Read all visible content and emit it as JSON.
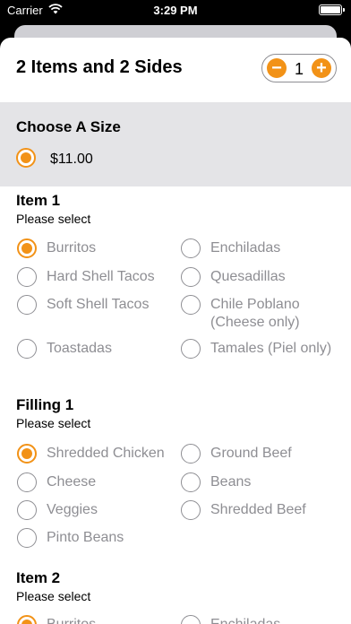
{
  "status": {
    "carrier": "Carrier",
    "time": "3:29 PM"
  },
  "header": {
    "title": "2 Items and 2 Sides",
    "quantity": "1",
    "minus": "−",
    "plus": "+"
  },
  "size": {
    "title": "Choose A Size",
    "price": "$11.00"
  },
  "item1": {
    "title": "Item 1",
    "subtitle": "Please select",
    "options": [
      "Burritos",
      "Enchiladas",
      "Hard Shell Tacos",
      "Quesadillas",
      "Soft Shell Tacos",
      "Chile Poblano (Cheese only)",
      "Toastadas",
      "Tamales (Piel only)"
    ],
    "selected": "Burritos"
  },
  "filling1": {
    "title": "Filling 1",
    "subtitle": "Please select",
    "options": [
      "Shredded Chicken",
      "Ground Beef",
      "Cheese",
      "Beans",
      "Veggies",
      "Shredded Beef",
      "Pinto Beans"
    ],
    "selected": "Shredded Chicken"
  },
  "item2": {
    "title": "Item 2",
    "subtitle": "Please select",
    "options": [
      "Burritos",
      "Enchiladas"
    ],
    "selected": "Burritos"
  },
  "colors": {
    "accent": "#f29217",
    "unselected_text": "#8e8e93"
  }
}
